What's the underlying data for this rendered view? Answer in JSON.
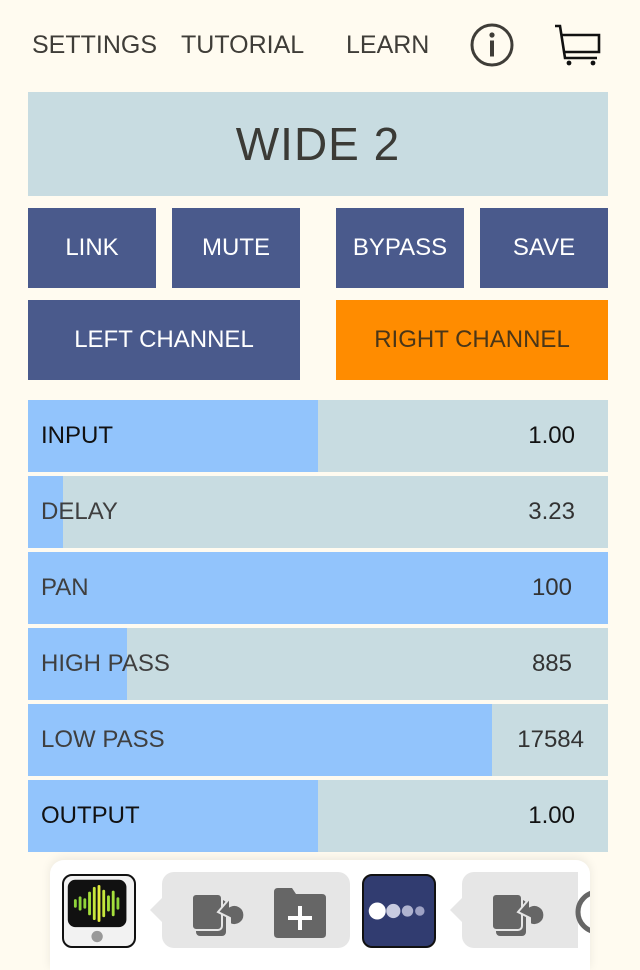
{
  "topnav": {
    "settings": "SETTINGS",
    "tutorial": "TUTORIAL",
    "learn": "LEARN",
    "info_icon": "info-icon",
    "cart_icon": "cart-icon"
  },
  "preset": {
    "name": "WIDE 2"
  },
  "buttons": {
    "link": "LINK",
    "mute": "MUTE",
    "bypass": "BYPASS",
    "save": "SAVE",
    "left_channel": "LEFT CHANNEL",
    "right_channel": "RIGHT CHANNEL",
    "selected_channel": "right"
  },
  "sliders": [
    {
      "label": "INPUT",
      "value": "1.00",
      "fill": 0.5
    },
    {
      "label": "DELAY",
      "value": "3.23",
      "fill": 0.06
    },
    {
      "label": "PAN",
      "value": "100",
      "fill": 1.0
    },
    {
      "label": "HIGH PASS",
      "value": "885",
      "fill": 0.17
    },
    {
      "label": "LOW PASS",
      "value": "17584",
      "fill": 0.8
    },
    {
      "label": "OUTPUT",
      "value": "1.00",
      "fill": 0.5
    }
  ],
  "dock": {
    "items": [
      {
        "icon": "waveform-app-icon"
      },
      {
        "icon": "audio-route-icon"
      },
      {
        "icon": "folder-add-icon"
      },
      {
        "icon": "dots-app-icon"
      },
      {
        "icon": "audio-route-icon"
      }
    ]
  },
  "colors": {
    "background": "#fffbf0",
    "button": "#4a5a8c",
    "active": "#ff8c00",
    "track": "#c8dce1",
    "fill": "#92c4fc"
  }
}
